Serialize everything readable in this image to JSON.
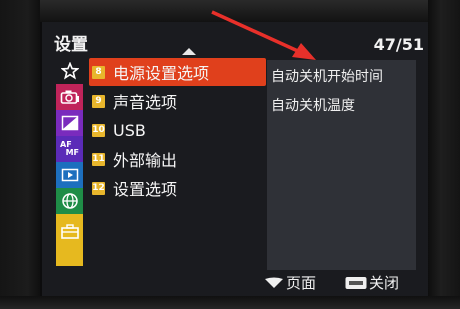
{
  "header": {
    "title": "设置",
    "page_indicator": "47/51"
  },
  "tabs": [
    {
      "icon": "star-icon",
      "color": "#3a3a3a"
    },
    {
      "icon": "camera-icon",
      "color": "#c0245a"
    },
    {
      "icon": "playback-image-icon",
      "color": "#7a2bbd"
    },
    {
      "icon": "af-mf-icon",
      "color": "#5b2bb8"
    },
    {
      "icon": "play-icon",
      "color": "#1d6fbe"
    },
    {
      "icon": "network-globe-icon",
      "color": "#1f8d47"
    },
    {
      "icon": "toolbox-icon",
      "color": "#e6b91f"
    }
  ],
  "menu": {
    "items": [
      {
        "num": "8",
        "label": "电源设置选项",
        "selected": true
      },
      {
        "num": "9",
        "label": "声音选项"
      },
      {
        "num": "10",
        "label": "USB"
      },
      {
        "num": "11",
        "label": "外部输出"
      },
      {
        "num": "12",
        "label": "设置选项"
      }
    ]
  },
  "submenu": {
    "items": [
      "自动关机开始时间",
      "自动关机温度"
    ]
  },
  "footer": {
    "page_label": "页面",
    "close_label": "关闭"
  },
  "colors": {
    "selected": "#e0401c",
    "number_badge": "#e8b62c",
    "annotation_arrow": "#e8302a"
  }
}
